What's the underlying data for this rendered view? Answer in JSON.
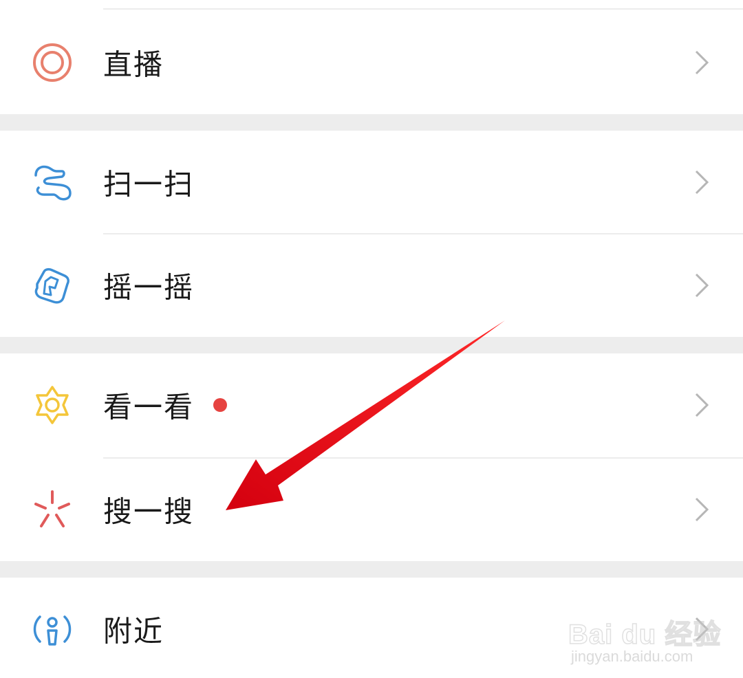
{
  "menu": {
    "items": [
      {
        "id": "live",
        "label": "直播",
        "icon": "live-target-icon"
      },
      {
        "id": "scan",
        "label": "扫一扫",
        "icon": "scan-icon"
      },
      {
        "id": "shake",
        "label": "摇一摇",
        "icon": "shake-icon"
      },
      {
        "id": "top-stories",
        "label": "看一看",
        "icon": "top-stories-icon",
        "badge": "red-dot"
      },
      {
        "id": "search",
        "label": "搜一搜",
        "icon": "search-star-icon"
      },
      {
        "id": "nearby",
        "label": "附近",
        "icon": "nearby-person-icon"
      }
    ]
  },
  "annotation": {
    "arrow_color": "#e60012",
    "points_to": "搜一搜"
  },
  "watermark": {
    "brand": "Bai du 经验",
    "url": "jingyan.baidu.com"
  },
  "colors": {
    "background": "#ededed",
    "card": "#ffffff",
    "live_icon": "#e8806d",
    "scan_icon": "#3d8fd6",
    "shake_icon": "#3d8fd6",
    "top_stories_icon": "#f4c63a",
    "search_icon": "#e05a5a",
    "nearby_icon": "#3d8fd6",
    "badge": "#e64340",
    "chevron": "#b6b6b6"
  }
}
